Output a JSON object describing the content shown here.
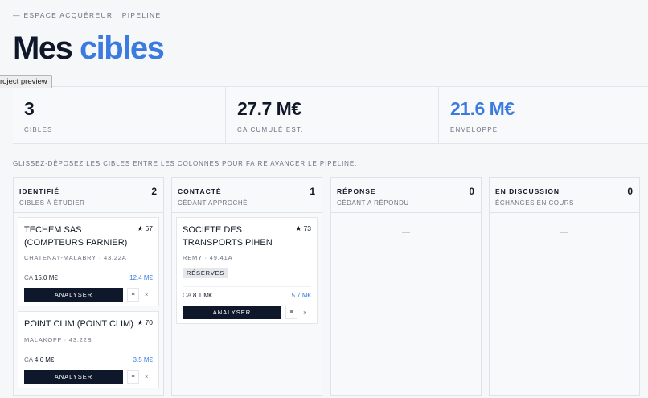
{
  "header": {
    "eyebrow": "— ESPACE ACQUÉREUR · PIPELINE",
    "title_main": "Mes",
    "title_accent": "cibles",
    "tooltip": "roject preview"
  },
  "stats": [
    {
      "value": "3",
      "label": "CIBLES"
    },
    {
      "value": "27.7 M€",
      "label": "CA CUMULÉ EST."
    },
    {
      "value": "21.6 M€",
      "label": "ENVELOPPE"
    }
  ],
  "hint": "GLISSEZ-DÉPOSEZ LES CIBLES ENTRE LES COLONNES POUR FAIRE AVANCER LE PIPELINE.",
  "columns": [
    {
      "title": "IDENTIFIÉ",
      "subtitle": "CIBLES À ÉTUDIER",
      "count": "2",
      "cards": [
        {
          "name": "TECHEM SAS (COMPTEURS FARNIER)",
          "score": "★ 67",
          "location": "CHATENAY-MALABRY · 43.22A",
          "ca_label": "CA",
          "ca": "15.0 M€",
          "envelope": "12.4 M€",
          "action": "ANALYSER",
          "icon_label": "≡",
          "remove": "×"
        },
        {
          "name": "POINT CLIM (POINT CLIM)",
          "score": "★ 70",
          "location": "MALAKOFF · 43.22B",
          "ca_label": "CA",
          "ca": "4.6 M€",
          "envelope": "3.5 M€",
          "action": "ANALYSER",
          "icon_label": "≡",
          "remove": "×"
        }
      ]
    },
    {
      "title": "CONTACTÉ",
      "subtitle": "CÉDANT APPROCHÉ",
      "count": "1",
      "cards": [
        {
          "name": "SOCIETE DES TRANSPORTS PIHEN",
          "score": "★ 73",
          "location": "REMY · 49.41A",
          "tag": "RÉSERVES",
          "ca_label": "CA",
          "ca": "8.1 M€",
          "envelope": "5.7 M€",
          "action": "ANALYSER",
          "icon_label": "≡",
          "remove": "×"
        }
      ]
    },
    {
      "title": "RÉPONSE",
      "subtitle": "CÉDANT A RÉPONDU",
      "count": "0",
      "empty": "—"
    },
    {
      "title": "EN DISCUSSION",
      "subtitle": "ÉCHANGES EN COURS",
      "count": "0",
      "empty": "—"
    }
  ],
  "colors": {
    "accent": "#3b7be0",
    "dark": "#0f172a",
    "muted": "#6b7280"
  }
}
